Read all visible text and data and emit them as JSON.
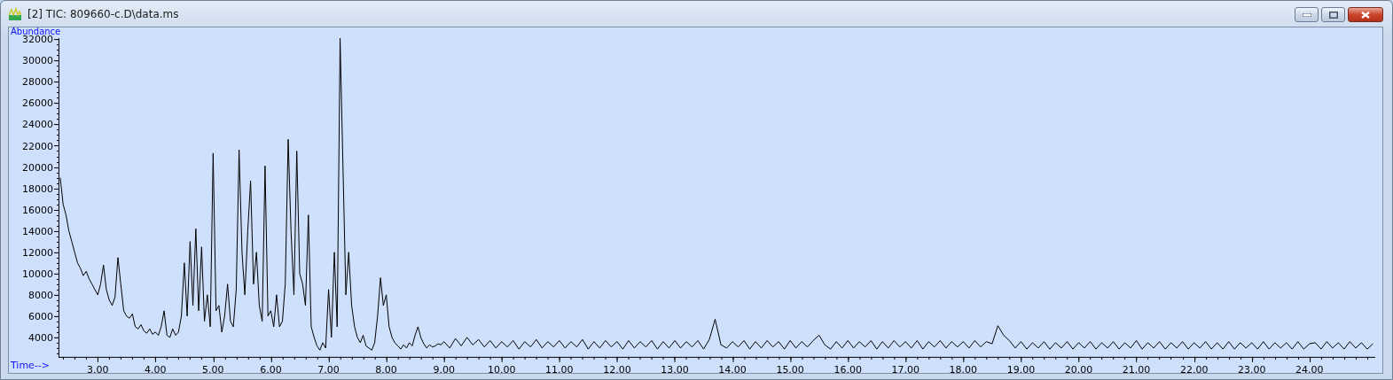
{
  "window": {
    "title": "[2] TIC: 809660-c.D\\data.ms"
  },
  "chart": {
    "chart_data": {
      "type": "line",
      "xlabel": "Time-->",
      "ylabel": "Abundance",
      "xlim": [
        2.32,
        25.14
      ],
      "ylim": [
        2170,
        32100
      ],
      "xticks": [
        {
          "value": 3,
          "label": "3.00"
        },
        {
          "value": 4,
          "label": "4.00"
        },
        {
          "value": 5,
          "label": "5.00"
        },
        {
          "value": 6,
          "label": "6.00"
        },
        {
          "value": 7,
          "label": "7.00"
        },
        {
          "value": 8,
          "label": "8.00"
        },
        {
          "value": 9,
          "label": "9.00"
        },
        {
          "value": 10,
          "label": "10.00"
        },
        {
          "value": 11,
          "label": "11.00"
        },
        {
          "value": 12,
          "label": "12.00"
        },
        {
          "value": 13,
          "label": "13.00"
        },
        {
          "value": 14,
          "label": "14.00"
        },
        {
          "value": 15,
          "label": "15.00"
        },
        {
          "value": 16,
          "label": "16.00"
        },
        {
          "value": 17,
          "label": "17.00"
        },
        {
          "value": 18,
          "label": "18.00"
        },
        {
          "value": 19,
          "label": "19.00"
        },
        {
          "value": 20,
          "label": "20.00"
        },
        {
          "value": 21,
          "label": "21.00"
        },
        {
          "value": 22,
          "label": "22.00"
        },
        {
          "value": 23,
          "label": "23.00"
        },
        {
          "value": 24,
          "label": "24.00"
        }
      ],
      "yticks": [
        4000,
        6000,
        8000,
        10000,
        12000,
        14000,
        16000,
        18000,
        20000,
        22000,
        24000,
        26000,
        28000,
        30000,
        32000
      ],
      "x": [
        2.35,
        2.4,
        2.45,
        2.5,
        2.55,
        2.6,
        2.65,
        2.7,
        2.75,
        2.8,
        2.85,
        2.9,
        2.95,
        3.0,
        3.05,
        3.1,
        3.15,
        3.2,
        3.25,
        3.3,
        3.35,
        3.4,
        3.45,
        3.5,
        3.55,
        3.6,
        3.65,
        3.7,
        3.75,
        3.8,
        3.85,
        3.9,
        3.95,
        4.0,
        4.05,
        4.1,
        4.15,
        4.2,
        4.25,
        4.3,
        4.35,
        4.4,
        4.45,
        4.5,
        4.55,
        4.6,
        4.65,
        4.7,
        4.75,
        4.8,
        4.85,
        4.9,
        4.95,
        5.0,
        5.05,
        5.1,
        5.15,
        5.2,
        5.25,
        5.3,
        5.35,
        5.4,
        5.45,
        5.5,
        5.55,
        5.6,
        5.65,
        5.7,
        5.75,
        5.8,
        5.85,
        5.9,
        5.95,
        6.0,
        6.05,
        6.1,
        6.15,
        6.2,
        6.25,
        6.3,
        6.35,
        6.4,
        6.45,
        6.5,
        6.55,
        6.6,
        6.65,
        6.7,
        6.75,
        6.8,
        6.85,
        6.9,
        6.95,
        7.0,
        7.05,
        7.1,
        7.15,
        7.2,
        7.25,
        7.3,
        7.35,
        7.4,
        7.45,
        7.5,
        7.55,
        7.6,
        7.65,
        7.7,
        7.75,
        7.8,
        7.85,
        7.9,
        7.95,
        8.0,
        8.05,
        8.1,
        8.15,
        8.2,
        8.25,
        8.3,
        8.35,
        8.4,
        8.45,
        8.5,
        8.55,
        8.6,
        8.65,
        8.7,
        8.75,
        8.8,
        8.85,
        8.9,
        8.95,
        9.0,
        9.1,
        9.2,
        9.3,
        9.4,
        9.5,
        9.6,
        9.7,
        9.8,
        9.9,
        10.0,
        10.1,
        10.2,
        10.3,
        10.4,
        10.5,
        10.6,
        10.7,
        10.8,
        10.9,
        11.0,
        11.1,
        11.2,
        11.3,
        11.4,
        11.5,
        11.6,
        11.7,
        11.8,
        11.9,
        12.0,
        12.1,
        12.2,
        12.3,
        12.4,
        12.5,
        12.6,
        12.7,
        12.8,
        12.9,
        13.0,
        13.1,
        13.2,
        13.3,
        13.4,
        13.5,
        13.6,
        13.7,
        13.8,
        13.9,
        14.0,
        14.1,
        14.2,
        14.3,
        14.4,
        14.5,
        14.6,
        14.7,
        14.8,
        14.9,
        15.0,
        15.1,
        15.2,
        15.3,
        15.4,
        15.5,
        15.6,
        15.7,
        15.8,
        15.9,
        16.0,
        16.1,
        16.2,
        16.3,
        16.4,
        16.5,
        16.6,
        16.7,
        16.8,
        16.9,
        17.0,
        17.1,
        17.2,
        17.3,
        17.4,
        17.5,
        17.6,
        17.7,
        17.8,
        17.9,
        18.0,
        18.1,
        18.2,
        18.3,
        18.4,
        18.5,
        18.6,
        18.7,
        18.8,
        18.9,
        19.0,
        19.1,
        19.2,
        19.3,
        19.4,
        19.5,
        19.6,
        19.7,
        19.8,
        19.9,
        20.0,
        20.1,
        20.2,
        20.3,
        20.4,
        20.5,
        20.6,
        20.7,
        20.8,
        20.9,
        21.0,
        21.1,
        21.2,
        21.3,
        21.4,
        21.5,
        21.6,
        21.7,
        21.8,
        21.9,
        22.0,
        22.1,
        22.2,
        22.3,
        22.4,
        22.5,
        22.6,
        22.7,
        22.8,
        22.9,
        23.0,
        23.1,
        23.2,
        23.3,
        23.4,
        23.5,
        23.6,
        23.7,
        23.8,
        23.9,
        24.0,
        24.1,
        24.2,
        24.3,
        24.4,
        24.5,
        24.6,
        24.7,
        24.8,
        24.9,
        25.0,
        25.1
      ],
      "series": [
        {
          "color": "#000000",
          "values": [
            19000,
            16500,
            15500,
            14000,
            13000,
            12000,
            11000,
            10500,
            9800,
            10200,
            9500,
            9000,
            8500,
            8000,
            9000,
            10800,
            8500,
            7500,
            7000,
            7800,
            11500,
            9000,
            6500,
            6000,
            5800,
            6200,
            5000,
            4800,
            5200,
            4600,
            4400,
            4800,
            4300,
            4500,
            4200,
            5000,
            6500,
            4200,
            4000,
            4800,
            4200,
            4500,
            6000,
            11000,
            6000,
            13000,
            7000,
            14200,
            6500,
            12500,
            5500,
            8000,
            5000,
            21300,
            6500,
            7000,
            4500,
            6000,
            9000,
            5500,
            5000,
            8500,
            21600,
            12000,
            8000,
            14000,
            18700,
            9000,
            12000,
            7000,
            5500,
            20100,
            6000,
            6500,
            5000,
            8000,
            5000,
            5500,
            9000,
            22600,
            14000,
            8000,
            21500,
            10000,
            9000,
            7000,
            15500,
            5000,
            4000,
            3200,
            2800,
            3500,
            3000,
            8500,
            4000,
            12000,
            5000,
            32100,
            20200,
            8000,
            12000,
            7000,
            5000,
            4000,
            3500,
            4200,
            3200,
            3000,
            2800,
            3500,
            6000,
            9600,
            7000,
            8000,
            5000,
            4000,
            3500,
            3200,
            2900,
            3300,
            3000,
            3500,
            3200,
            4200,
            5000,
            4000,
            3400,
            3000,
            3300,
            3100,
            3200,
            3400,
            3300,
            3600,
            3000,
            3900,
            3200,
            4000,
            3300,
            3800,
            3100,
            3700,
            3000,
            3600,
            3100,
            3700,
            2900,
            3600,
            3100,
            3800,
            3000,
            3600,
            3100,
            3700,
            3000,
            3600,
            3100,
            3800,
            2900,
            3600,
            3000,
            3700,
            3100,
            3600,
            2900,
            3700,
            3000,
            3600,
            3100,
            3700,
            2900,
            3600,
            3000,
            3700,
            3000,
            3600,
            3100,
            3700,
            2900,
            3800,
            5700,
            3300,
            3000,
            3600,
            3100,
            3700,
            2900,
            3600,
            3000,
            3700,
            3100,
            3600,
            2900,
            3700,
            3000,
            3600,
            3100,
            3700,
            4200,
            3300,
            2900,
            3600,
            3000,
            3700,
            3000,
            3600,
            3100,
            3700,
            2900,
            3600,
            3000,
            3700,
            3100,
            3600,
            3000,
            3700,
            2900,
            3600,
            3100,
            3700,
            3000,
            3600,
            3100,
            3600,
            3000,
            3700,
            3100,
            3600,
            3400,
            5100,
            4200,
            3700,
            3000,
            3600,
            2900,
            3500,
            3000,
            3600,
            2900,
            3500,
            3000,
            3600,
            2900,
            3500,
            3000,
            3600,
            2900,
            3500,
            3000,
            3600,
            2900,
            3500,
            3000,
            3700,
            2900,
            3500,
            3000,
            3600,
            2900,
            3500,
            3000,
            3600,
            2900,
            3500,
            3000,
            3600,
            2900,
            3500,
            2900,
            3600,
            2900,
            3500,
            3000,
            3500,
            2900,
            3600,
            2900,
            3500,
            3000,
            3500,
            2900,
            3600,
            2900,
            3400,
            3500,
            2900,
            3600,
            3000,
            3500,
            2900,
            3600,
            3000,
            3500,
            2900,
            3400
          ]
        }
      ]
    }
  }
}
